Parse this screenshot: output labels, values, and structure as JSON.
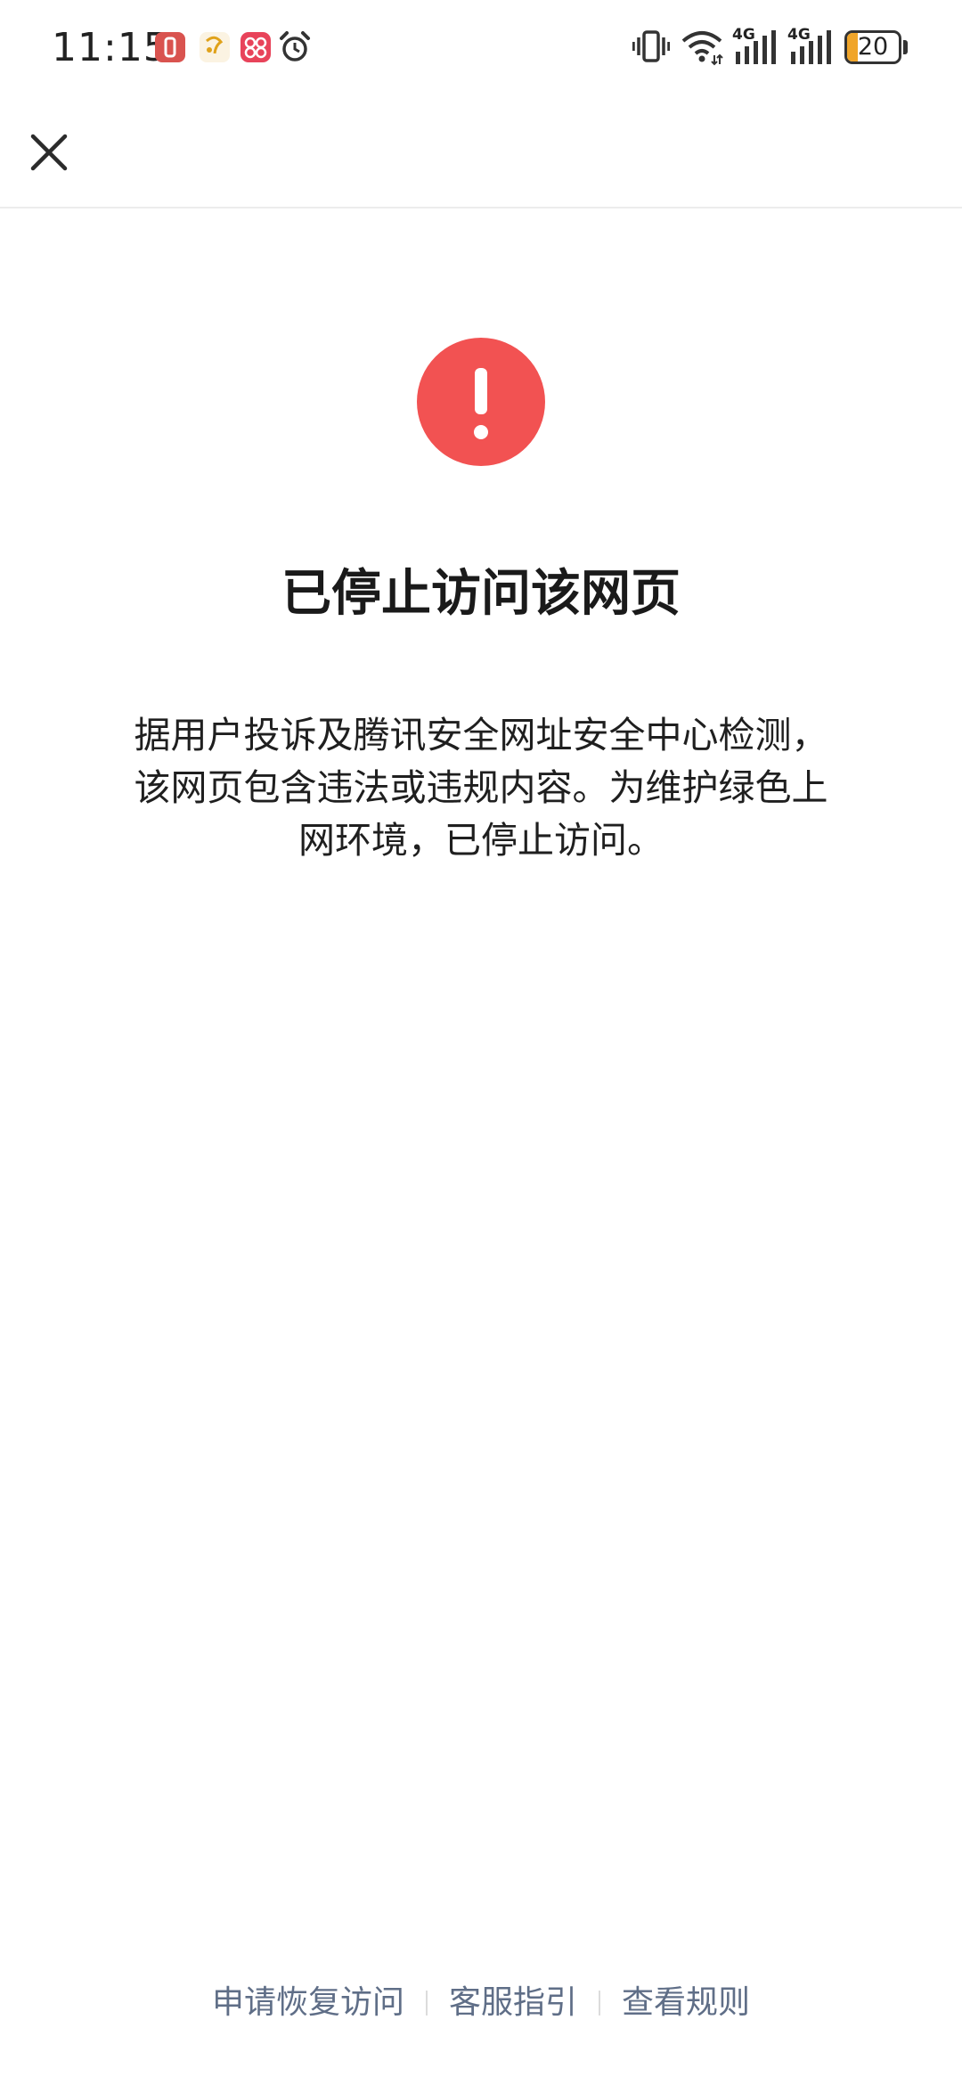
{
  "status_bar": {
    "time": "11:15",
    "network_1": "4G",
    "network_2": "4G",
    "battery_level": "20",
    "battery_fraction": 0.2,
    "notification_icons": [
      "app-notification-icon",
      "app-notification-icon",
      "app-notification-icon",
      "alarm-icon"
    ],
    "right_icons": [
      "vibrate-icon",
      "wifi-icon",
      "signal-icon",
      "signal-icon",
      "battery-icon"
    ]
  },
  "nav": {
    "close_icon": "close-icon"
  },
  "content": {
    "icon": "exclamation-icon",
    "icon_color": "#f25252",
    "title": "已停止访问该网页",
    "description_lines": [
      "据用户投诉及腾讯安全网址安全中心检测，",
      "该网页包含违法或违规内容。为维护绿色上",
      "网环境，已停止访问。"
    ]
  },
  "footer": {
    "links": [
      "申请恢复访问",
      "客服指引",
      "查看规则"
    ],
    "link_color": "#5f6e87"
  }
}
